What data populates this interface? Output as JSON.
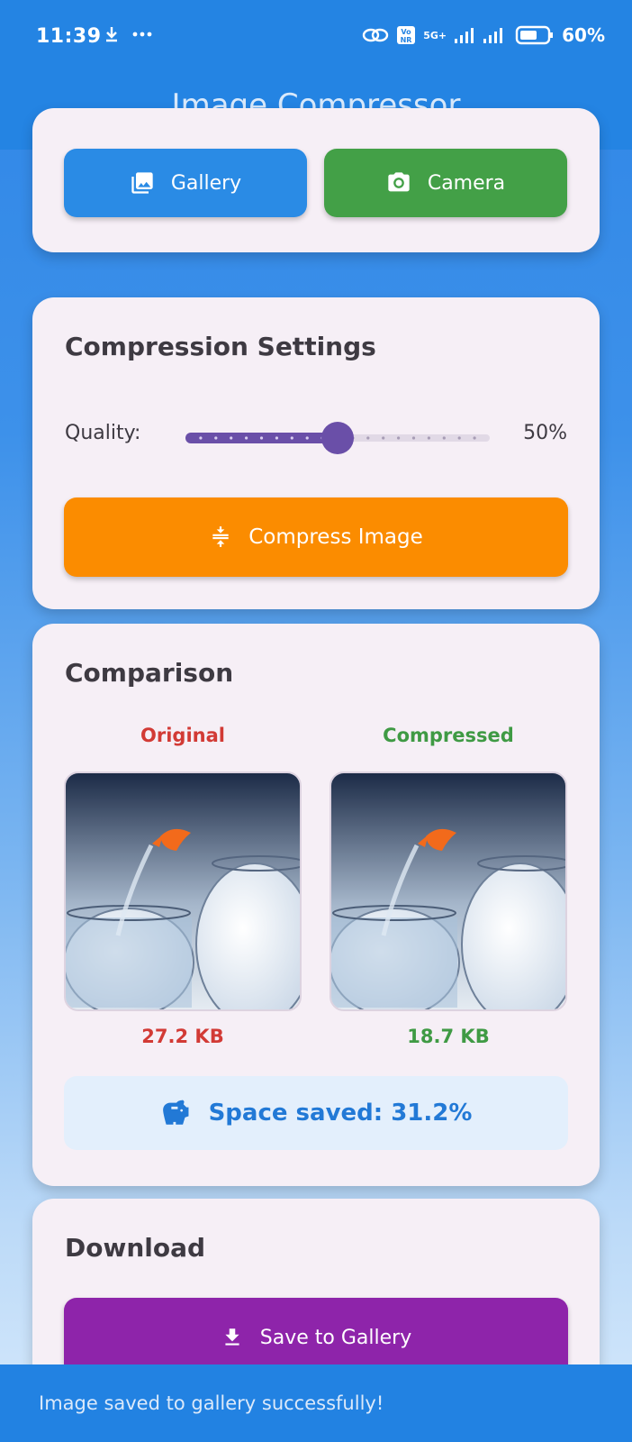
{
  "status_bar": {
    "time": "11:39",
    "network": "5G+",
    "battery": "60%"
  },
  "app": {
    "title": "Image Compressor"
  },
  "source": {
    "gallery_label": "Gallery",
    "camera_label": "Camera"
  },
  "settings": {
    "title": "Compression Settings",
    "quality_label": "Quality:",
    "quality_value": "50%",
    "quality": 0.5,
    "compress_label": "Compress Image"
  },
  "comparison": {
    "title": "Comparison",
    "original_label": "Original",
    "compressed_label": "Compressed",
    "original_size": "27.2 KB",
    "compressed_size": "18.7 KB",
    "saved_text": "Space saved: 31.2%"
  },
  "download": {
    "title": "Download",
    "save_label": "Save to Gallery"
  },
  "snackbar": {
    "message": "Image saved to gallery successfully!"
  },
  "colors": {
    "primary": "#2484e3",
    "gallery": "#2a8be5",
    "camera": "#43a047",
    "compress": "#fb8c00",
    "save": "#8e24aa",
    "slider": "#6a4fa8"
  }
}
